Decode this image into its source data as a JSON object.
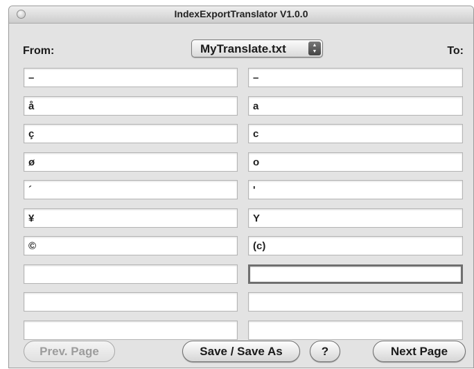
{
  "window": {
    "title": "IndexExportTranslator V1.0.0"
  },
  "labels": {
    "from": "From:",
    "to": "To:"
  },
  "file_popup": {
    "selected": "MyTranslate.txt",
    "icon": "up-down-arrows-icon"
  },
  "rows": [
    {
      "from": "–",
      "to": "–"
    },
    {
      "from": "å",
      "to": "a"
    },
    {
      "from": "ç",
      "to": "c"
    },
    {
      "from": "ø",
      "to": "o"
    },
    {
      "from": "´",
      "to": "'"
    },
    {
      "from": "¥",
      "to": "Y"
    },
    {
      "from": "©",
      "to": "(c)"
    },
    {
      "from": "",
      "to": ""
    },
    {
      "from": "",
      "to": ""
    },
    {
      "from": "",
      "to": ""
    }
  ],
  "buttons": {
    "prev": "Prev. Page",
    "save": "Save / Save As",
    "help": "?",
    "next": "Next Page"
  }
}
